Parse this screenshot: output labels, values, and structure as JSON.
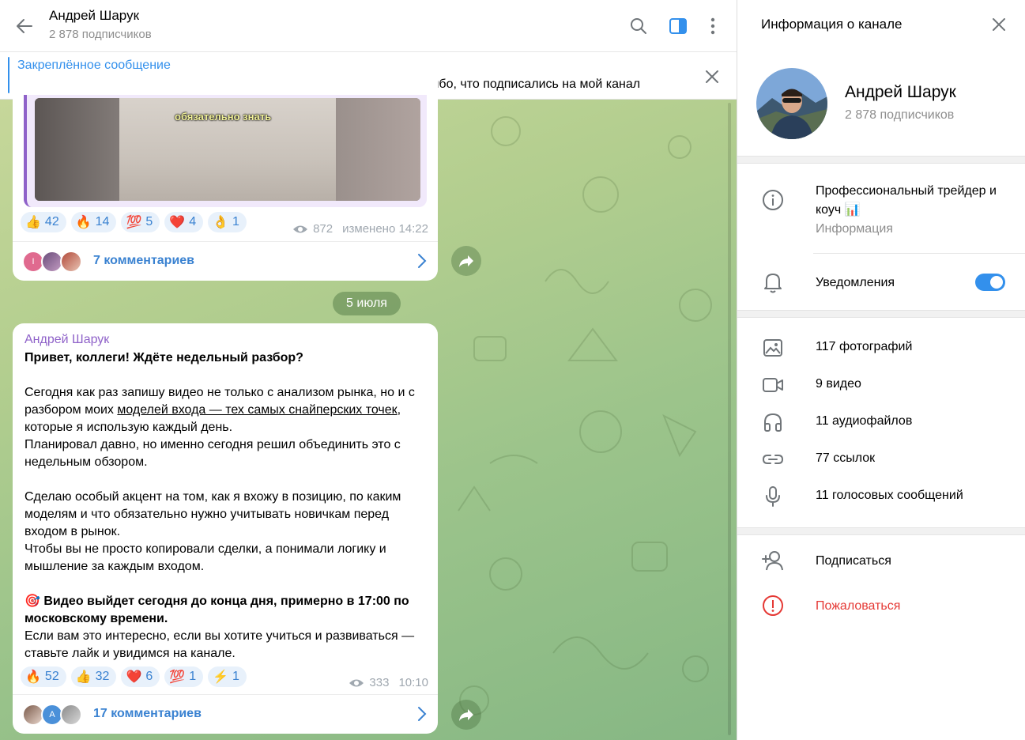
{
  "chat": {
    "title": "Андрей Шарук",
    "subtitle": "2 878 подписчиков",
    "pinned": {
      "title": "Закреплённое сообщение",
      "text": "🔥 Добро пожаловать, коллеги, трейдеры, предприниматели! 🔥 Спасибо, что подписались на мой канал"
    },
    "message1": {
      "video_caption": "обязательно знать",
      "reactions": [
        {
          "emoji": "👍",
          "count": "42"
        },
        {
          "emoji": "🔥",
          "count": "14"
        },
        {
          "emoji": "💯",
          "count": "5"
        },
        {
          "emoji": "❤️",
          "count": "4"
        },
        {
          "emoji": "👌",
          "count": "1"
        }
      ],
      "views": "872",
      "time": "изменено 14:22",
      "comments": "7 комментариев"
    },
    "date_separator": "5 июля",
    "message2": {
      "author": "Андрей Шарук",
      "line_heading": "Привет, коллеги! Ждёте недельный разбор?",
      "p1_a": "Сегодня как раз запишу видео не только с анализом рынка, но и с разбором моих ",
      "p1_link": "моделей входа — тех самых снайперских точек",
      "p1_b": ", которые я использую каждый день.",
      "p2": "Планировал давно, но именно сегодня решил объединить это с недельным обзором.",
      "p3": "Сделаю особый акцент на том, как я вхожу в позицию, по каким моделям и что обязательно нужно учитывать новичкам перед входом в рынок.",
      "p4": "Чтобы вы не просто копировали сделки, а понимали логику и мышление за каждым входом.",
      "p5_emoji": "🎯",
      "p5_bold": "Видео выйдет сегодня до конца дня, примерно в 17:00 по московскому времени.",
      "p6": "Если вам это интересно, если вы хотите учиться и развиваться — ставьте лайк и увидимся на канале.",
      "reactions": [
        {
          "emoji": "🔥",
          "count": "52"
        },
        {
          "emoji": "👍",
          "count": "32"
        },
        {
          "emoji": "❤️",
          "count": "6"
        },
        {
          "emoji": "💯",
          "count": "1"
        },
        {
          "emoji": "⚡",
          "count": "1"
        }
      ],
      "views": "333",
      "time": "10:10",
      "comments": "17 комментариев"
    }
  },
  "info": {
    "title": "Информация о канале",
    "name": "Андрей Шарук",
    "subscribers": "2 878 подписчиков",
    "description": "Профессиональный трейдер и коуч 📊",
    "description_label": "Информация",
    "notifications": "Уведомления",
    "notifications_on": true,
    "media": [
      {
        "icon": "photo-icon",
        "label": "117 фотографий"
      },
      {
        "icon": "video-icon",
        "label": "9 видео"
      },
      {
        "icon": "headphones-icon",
        "label": "11 аудиофайлов"
      },
      {
        "icon": "link-icon",
        "label": "77 ссылок"
      },
      {
        "icon": "microphone-icon",
        "label": "11 голосовых сообщений"
      }
    ],
    "subscribe": "Подписаться",
    "report": "Пожаловаться"
  },
  "colors": {
    "accent": "#3390ec",
    "author": "#8f62c9",
    "danger": "#e53935"
  }
}
